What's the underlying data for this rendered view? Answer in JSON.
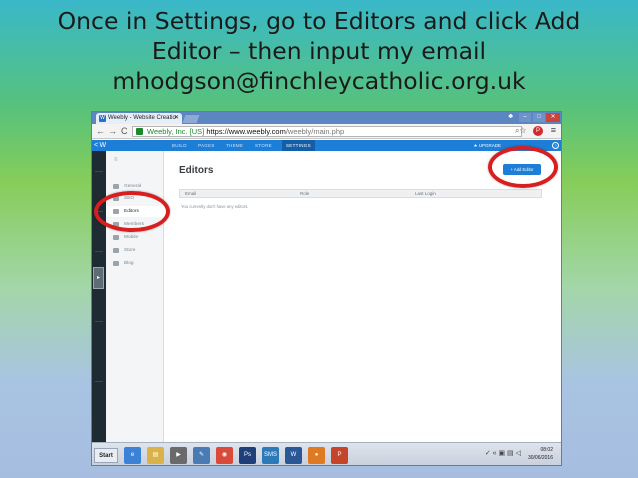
{
  "instruction": {
    "lines": [
      "Once in Settings, go to Editors and click Add",
      "Editor – then input my email",
      "mhodgson@finchleycatholic.org.uk"
    ]
  },
  "browser": {
    "tab_title": "Weebly - Website Creatio",
    "tab_logo": "W",
    "tab_close": "✕",
    "window_min": "–",
    "window_max": "□",
    "window_close": "✕",
    "user_icon": "♣",
    "back": "←",
    "forward": "→",
    "reload": "C",
    "secure_label": "Weebly, Inc. [US]",
    "url_host": "https://www.weebly.com",
    "url_path": "/weebly/main.php",
    "omnibox_icons": "⌕☆",
    "pin_label": "P",
    "menu_icon": "≡"
  },
  "weebly_nav": {
    "logo": "< W",
    "items": [
      "BUILD",
      "PAGES",
      "THEME",
      "STORE",
      "SETTINGS"
    ],
    "active": "SETTINGS",
    "upgrade": "★ UPGRADE",
    "help": "?"
  },
  "sidebar": {
    "collapse_icon": "≡",
    "items": [
      "General",
      "SEO",
      "Editors",
      "Members",
      "Mobile",
      "Store",
      "Blog"
    ],
    "active": "Editors"
  },
  "main": {
    "title": "Editors",
    "add_button": "+ Add Editor",
    "columns": [
      "Email",
      "Role",
      "Last Login"
    ],
    "empty_message": "You currently don't have any editors."
  },
  "taskbar": {
    "start": "Start",
    "apps": [
      {
        "name": "ie",
        "label": "e",
        "color": "#3b82d6"
      },
      {
        "name": "explorer",
        "label": "▤",
        "color": "#d9b34a"
      },
      {
        "name": "media",
        "label": "▶",
        "color": "#6a6a6a"
      },
      {
        "name": "notepad",
        "label": "✎",
        "color": "#4a7bb5"
      },
      {
        "name": "chrome",
        "label": "◉",
        "color": "#d94a3a"
      },
      {
        "name": "photoshop",
        "label": "Ps",
        "color": "#1f3f7a"
      },
      {
        "name": "sms",
        "label": "SMS",
        "color": "#2c7ab8"
      },
      {
        "name": "word",
        "label": "W",
        "color": "#2b5797"
      },
      {
        "name": "firefox",
        "label": "●",
        "color": "#e07a22"
      },
      {
        "name": "powerpoint",
        "label": "P",
        "color": "#c5452b"
      }
    ],
    "tray_icons": "✓ « ▣ ▤ ◁",
    "time": "08:02",
    "date": "30/06/2016"
  },
  "colors": {
    "highlight": "#d81e1e",
    "weebly_blue": "#1c7ed6"
  }
}
